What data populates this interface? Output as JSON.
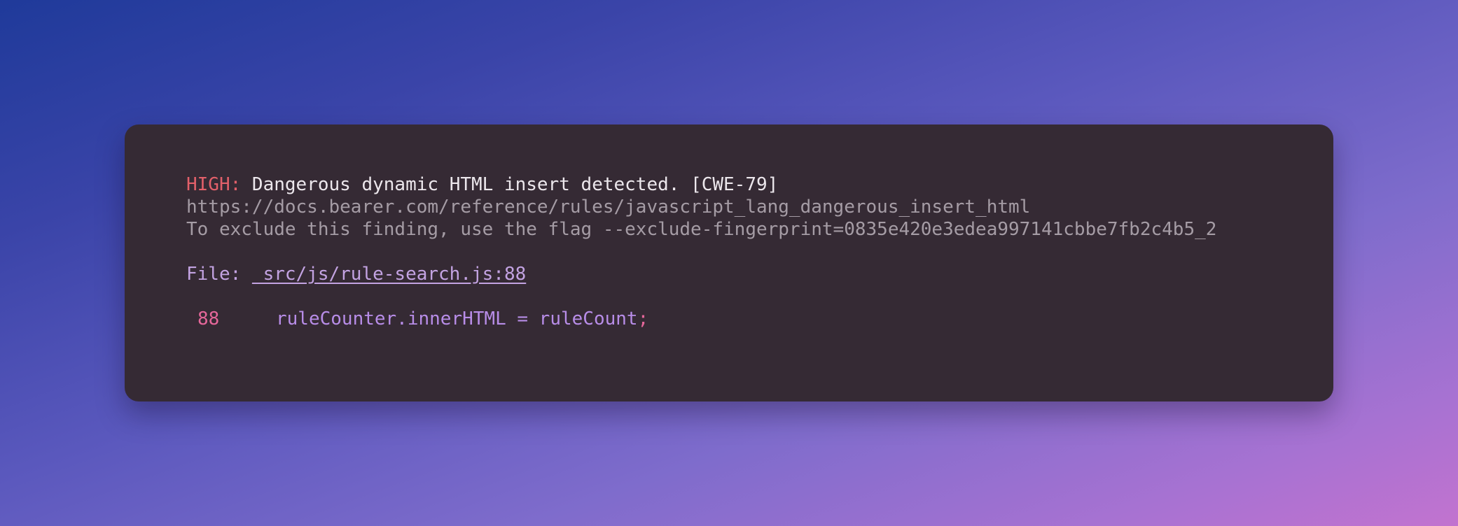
{
  "finding": {
    "severity_label": "HIGH:",
    "message": " Dangerous dynamic HTML insert detected. [CWE-79]",
    "doc_url": "https://docs.bearer.com/reference/rules/javascript_lang_dangerous_insert_html",
    "exclude_text": "To exclude this finding, use the flag --exclude-fingerprint=0835e420e3edea997141cbbe7fb2c4b5_2",
    "file_label": "File: ",
    "file_path": "_src/js/rule-search.js:88",
    "code_line_number": "88",
    "code_text": "ruleCounter.innerHTML = ruleCount",
    "code_end": ";"
  },
  "colors": {
    "severity_high": "#e2606a",
    "card_background": "#352a34",
    "file_accent": "#c3a3e2",
    "line_number": "#e5679a"
  }
}
